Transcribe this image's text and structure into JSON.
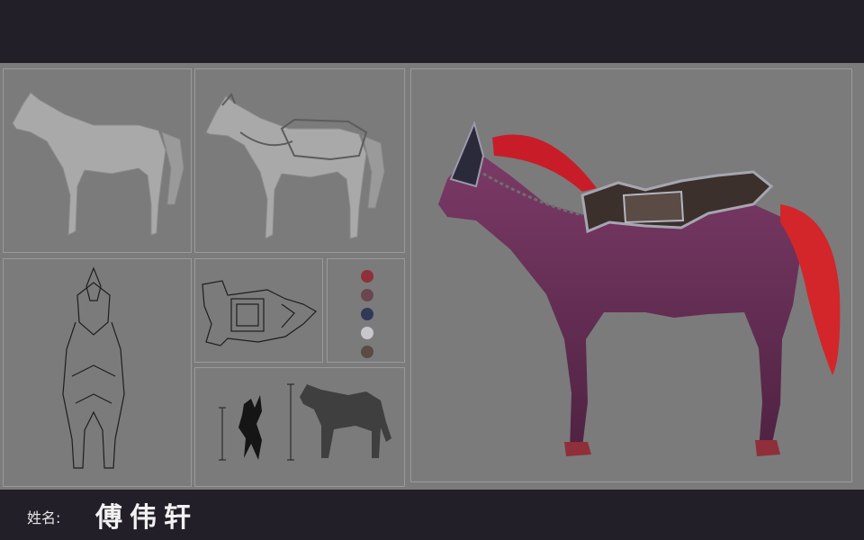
{
  "footer": {
    "name_label": "姓名:",
    "name_value": "傅伟轩"
  },
  "palette": {
    "swatches": [
      "#8f2f3a",
      "#6a4750",
      "#303957",
      "#c8c8cc",
      "#5a4b45"
    ]
  },
  "colors": {
    "background_bar": "#231f29",
    "sheet": "#7b7b7b",
    "horse_body": "#6b2f58",
    "mane": "#c81d28"
  }
}
